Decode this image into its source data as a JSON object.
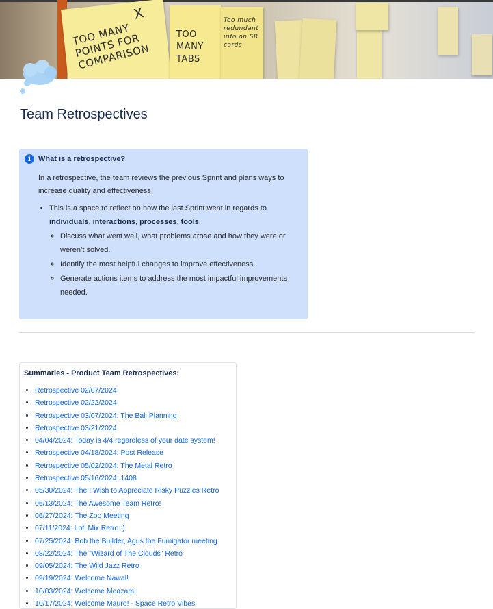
{
  "banner": {
    "note1_text": "TOO MANY POINTS FOR COMPARISON",
    "note1_mark": "X",
    "note2_text": "TOO MANY TABS",
    "note3_text": "Too much redundant info on SR cards"
  },
  "page": {
    "title": "Team Retrospectives"
  },
  "info_panel": {
    "heading": "What is a retrospective?",
    "intro": "In a retrospective, the team reviews the previous Sprint and plans ways to increase quality and effectiveness.",
    "bullet_prefix": "This is a space to reflect on how the last Sprint went in regards to",
    "terms": [
      "individuals",
      "interactions",
      "processes",
      "tools"
    ],
    "sep": ", ",
    "period": ".",
    "sub_items": [
      "Discuss what went well, what problems arose and how they were or weren’t solved.",
      "Identify the most helpful changes to improve effectiveness.",
      "Generate actions items to address the most impactful improvements needed."
    ]
  },
  "summaries": {
    "title": "Summaries - Product Team Retrospectives:",
    "items": [
      "Retrospective 02/07/2024",
      "Retrospective 02/22/2024",
      "Retrospective 03/07/2024: The Bali Planning",
      "Retrospective 03/21/2024",
      "04/04/2024: Today is 4/4 regardless of your date system!",
      "Retrospective 04/18/2024: Post Release",
      "Retrospective 05/02/2024: The Metal Retro",
      "Retrospective 05/16/2024: 1408",
      "05/30/2024: The I Wish to Appreciate Risky Puzzles Retro",
      "06/13/2024: The Awesome Team Retro!",
      "06/27/2024: The Zoo Meeting",
      "07/11/2024: Lofi Mix Retro :)",
      "07/25/2024: Bob the Builder, Agus the Fumigator meeting",
      "08/22/2024: The \"Wizard of The Clouds\" Retro",
      "09/05/2024: The Wild Jazz Retro",
      "09/19/2024: Welcome Nawal!",
      "10/03/2024: Welcome Moazam!",
      "10/17/2024: Welcome Mauro! - Space Retro Vibes"
    ]
  },
  "colors": {
    "panel_bg": "#cfe0fc",
    "info_icon": "#1868db",
    "link": "#0c66e4",
    "text": "#172b4d"
  },
  "icons": {
    "info": "info-circle-icon",
    "banner_emoji": "thought-balloon-icon"
  }
}
